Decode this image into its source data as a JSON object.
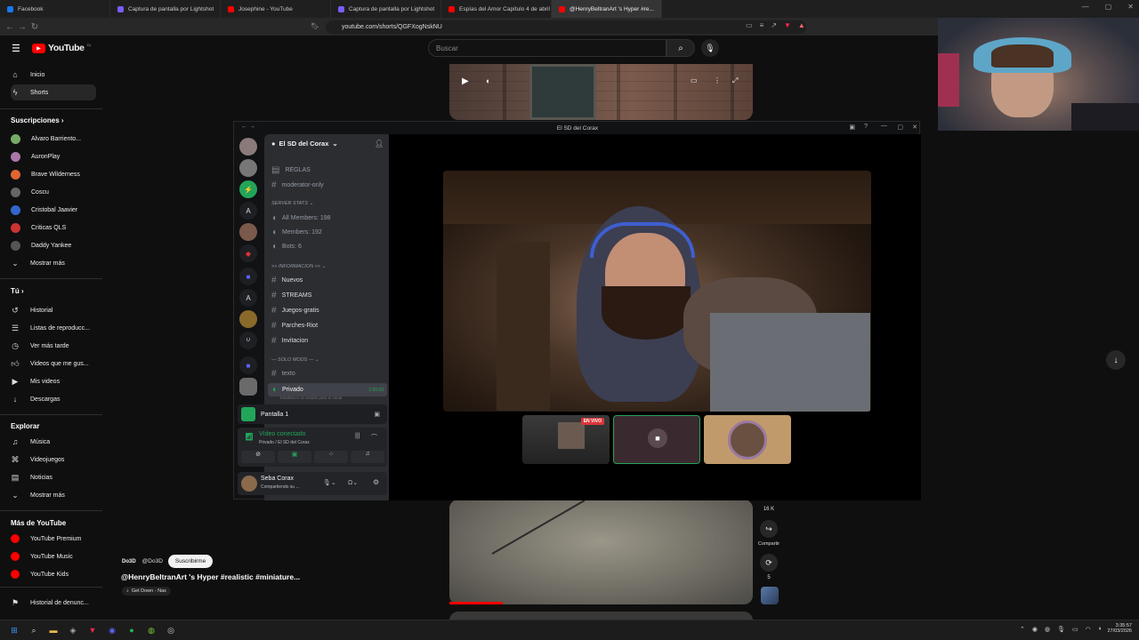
{
  "browser": {
    "tabs": [
      {
        "label": "Facebook",
        "color": "#1877f2"
      },
      {
        "label": "Captura de pantalla por Lightshot",
        "color": "#7b5cff"
      },
      {
        "label": "Josephine - YouTube",
        "color": "#ff0000"
      },
      {
        "label": "Captura de pantalla por Lightshot",
        "color": "#7b5cff"
      },
      {
        "label": "Espías del Amor Capítulo 4 de abril",
        "color": "#ff0000"
      },
      {
        "label": "@HenryBeltranArt 's Hyper #re...",
        "color": "#ff0000"
      }
    ],
    "url": "youtube.com/shorts/QGFXogNskNU"
  },
  "youtube": {
    "logo": "YouTube",
    "logo_sup": "CL",
    "search_placeholder": "Buscar",
    "nav": [
      {
        "label": "Inicio",
        "icon": "home-icon"
      },
      {
        "label": "Shorts",
        "icon": "shorts-icon"
      }
    ],
    "subs_title": "Suscripciones",
    "subs": [
      {
        "label": "Alvaro Barriento...",
        "color": "#7a6"
      },
      {
        "label": "AuronPlay",
        "color": "#a7a"
      },
      {
        "label": "Brave Wilderness",
        "color": "#d63"
      },
      {
        "label": "Coscu",
        "color": "#666"
      },
      {
        "label": "Cristobal Jaavier",
        "color": "#36c"
      },
      {
        "label": "Criticas QLS",
        "color": "#c33"
      },
      {
        "label": "Daddy Yankee",
        "color": "#555"
      }
    ],
    "show_more": "Mostrar más",
    "you_title": "Tú",
    "you": [
      {
        "label": "Historial",
        "icon": "history-icon"
      },
      {
        "label": "Listas de reproducc...",
        "icon": "playlist-icon"
      },
      {
        "label": "Ver más tarde",
        "icon": "clock-icon"
      },
      {
        "label": "Videos que me gus...",
        "icon": "like-icon"
      },
      {
        "label": "Mis videos",
        "icon": "video-icon"
      },
      {
        "label": "Descargas",
        "icon": "download-icon"
      }
    ],
    "explore_title": "Explorar",
    "explore": [
      {
        "label": "Música",
        "icon": "music-icon"
      },
      {
        "label": "Videojuegos",
        "icon": "gamepad-icon"
      },
      {
        "label": "Noticias",
        "icon": "news-icon"
      },
      {
        "label": "Mostrar más",
        "icon": "chevron-down-icon"
      }
    ],
    "more_title": "Más de YouTube",
    "more": [
      {
        "label": "YouTube Premium"
      },
      {
        "label": "YouTube Music"
      },
      {
        "label": "YouTube Kids"
      }
    ],
    "report": "Historial de denunc...",
    "short": {
      "channel": "@Do3D",
      "subscribe": "Suscribirme",
      "title": "@HenryBeltranArt 's Hyper #realistic #miniature...",
      "music": "Get Down - Nas",
      "likes": "16 K",
      "share": "Compartir",
      "remix_count": "5"
    }
  },
  "discord": {
    "window_title": "El SD del Corax",
    "server_name": "El SD del Corax",
    "channels": [
      {
        "label": "REGLAS",
        "type": "text"
      },
      {
        "label": "moderator-only",
        "type": "text"
      }
    ],
    "cat_stats": "SERVER STATS",
    "stats": [
      "All Members: 198",
      "Members: 192",
      "Bots: 6"
    ],
    "cat_info": ">> INFORMACION <<",
    "info_channels": [
      "Nuevos",
      "STREAMS",
      "Juegos-gratis",
      "Parches-Riot",
      "Invitacion"
    ],
    "cat_mods": "--- SOLO MODS ---",
    "mod_channels": [
      "texto"
    ],
    "voice_channel": "Privado",
    "voice_time": "1:50:33",
    "voice_hint": "Establecer un estado para el canal",
    "screen_label": "Pantalla 1",
    "connected": "Vídeo conectado",
    "connected_sub": "Privado / El SD del Corax",
    "user_name": "Seba Corax",
    "user_status": "Compartiendo su ...",
    "live_badge": "EN VIVO"
  },
  "taskbar": {
    "time": "3:35:57",
    "date": "27/03/2026"
  }
}
